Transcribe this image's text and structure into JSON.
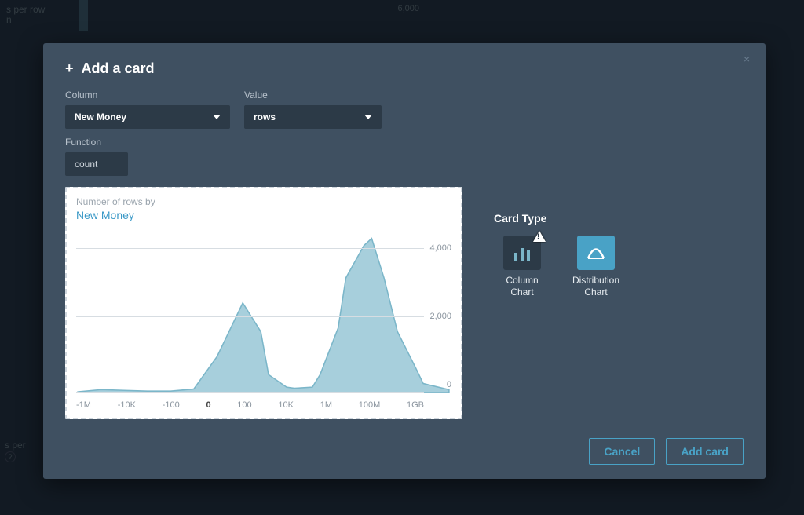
{
  "background": {
    "rows_label": "s per row",
    "n_label": "n",
    "number": "6,000",
    "s_per": "s per",
    "help_q": "?"
  },
  "modal": {
    "title": "Add a card",
    "close": "×",
    "column_label": "Column",
    "column_value": "New Money",
    "value_label": "Value",
    "value_value": "rows",
    "function_label": "Function",
    "function_value": "count",
    "preview": {
      "caption": "Number of rows by",
      "series": "New Money"
    },
    "card_type_title": "Card Type",
    "card_types": {
      "column": "Column Chart",
      "distribution": "Distribution Chart"
    },
    "cancel": "Cancel",
    "add": "Add card"
  },
  "chart_data": {
    "type": "area",
    "title": "Number of rows by New Money",
    "xlabel": "",
    "ylabel": "",
    "ylim": [
      0,
      4600
    ],
    "x_ticks": [
      "-1M",
      "-10K",
      "-100",
      "0",
      "100",
      "10K",
      "1M",
      "100M",
      "1GB"
    ],
    "y_ticks": [
      0,
      2000,
      4000
    ],
    "y_tick_labels": [
      "0",
      "2,000",
      "4,000"
    ],
    "series": [
      {
        "name": "New Money",
        "x": [
          -1000000,
          -100000,
          -10000,
          -1000,
          -100,
          -10,
          0,
          10,
          50,
          100,
          500,
          1000,
          5000,
          10000,
          50000,
          100000,
          500000,
          1000000,
          3000000,
          10000000,
          50000000,
          100000000,
          1000000000
        ],
        "values": [
          20,
          80,
          60,
          40,
          40,
          100,
          1000,
          2500,
          1700,
          500,
          150,
          120,
          150,
          500,
          1800,
          3200,
          4100,
          4300,
          3200,
          1700,
          700,
          250,
          80
        ]
      }
    ]
  }
}
